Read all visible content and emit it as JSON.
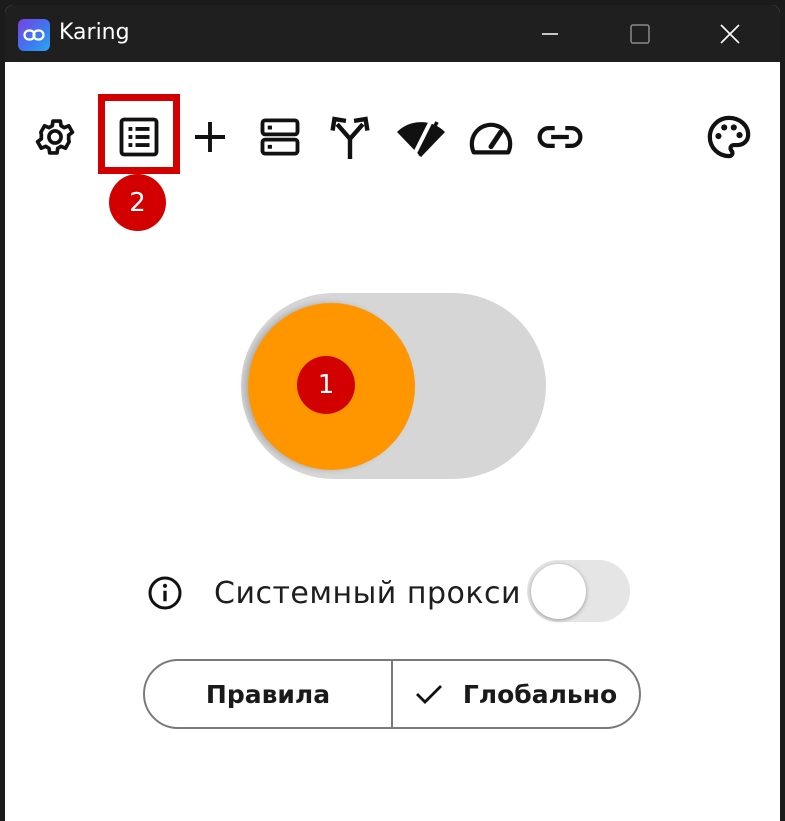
{
  "window": {
    "title": "Karing",
    "buttons": {
      "minimize": "minimize-icon",
      "maximize": "maximize-icon",
      "close": "close-icon"
    }
  },
  "toolbar": {
    "icons": [
      "gear-icon",
      "list-icon",
      "plus-icon",
      "servers-icon",
      "fork-icon",
      "wifi-off-icon",
      "speedometer-icon",
      "link-icon",
      "palette-icon"
    ]
  },
  "annotations": {
    "marker_1": "1",
    "marker_2": "2"
  },
  "main_switch": {
    "on": false,
    "knob_color": "#ff9600",
    "track_color": "#d6d6d6"
  },
  "system_proxy": {
    "label": "Системный прокси",
    "enabled": false
  },
  "mode": {
    "rules_label": "Правила",
    "global_label": "Глобально",
    "selected": "Глобально"
  },
  "colors": {
    "accent": "#ff9600",
    "annotation": "#d30000",
    "titlebar": "#1f1f1f"
  }
}
